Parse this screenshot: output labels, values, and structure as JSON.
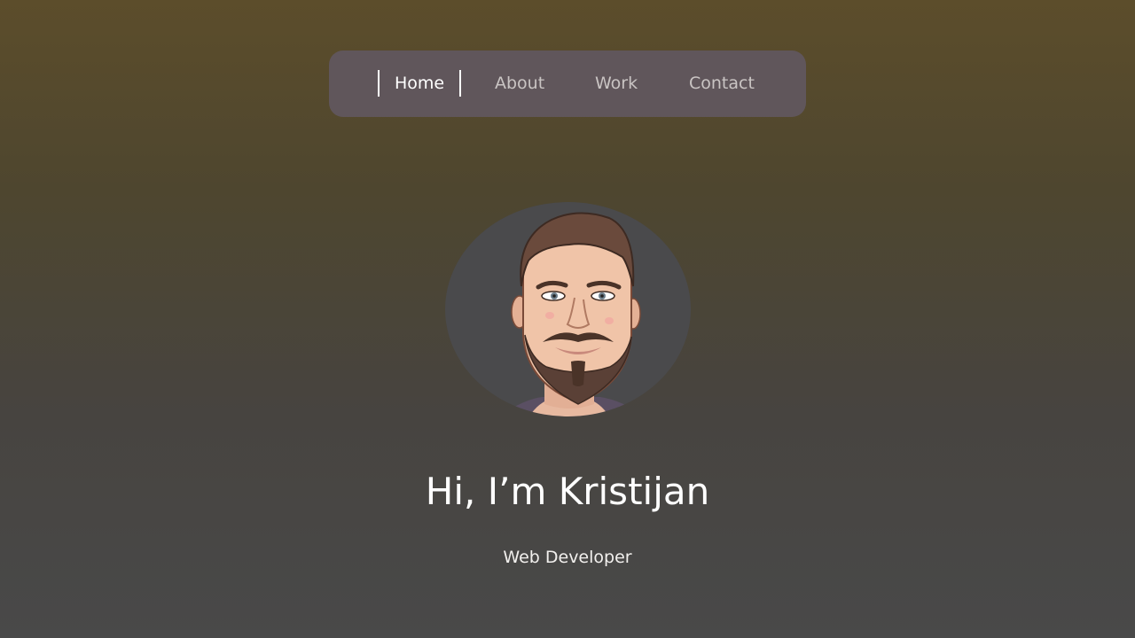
{
  "nav": {
    "items": [
      {
        "label": "Home",
        "active": true
      },
      {
        "label": "About",
        "active": false
      },
      {
        "label": "Work",
        "active": false
      },
      {
        "label": "Contact",
        "active": false
      }
    ]
  },
  "hero": {
    "avatar_icon": "cartoon-portrait",
    "headline": "Hi, I’m Kristijan",
    "subtitle": "Web Developer"
  },
  "colors": {
    "nav_background": "#60565b",
    "active_text": "#ffffff",
    "inactive_text": "#c9c4c3",
    "avatar_background": "#4a4a4c"
  }
}
